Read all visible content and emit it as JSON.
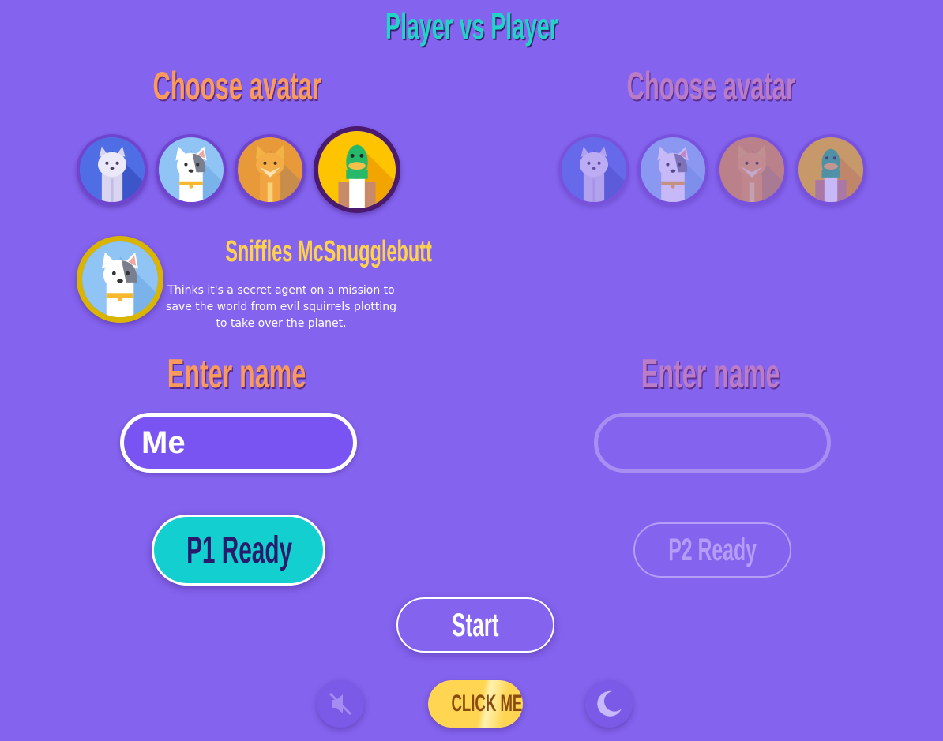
{
  "title": "Player vs Player",
  "player1": {
    "choose_label": "Choose avatar",
    "enter_label": "Enter name",
    "name_value": "Me",
    "ready_label": "P1 Ready",
    "selected_avatar": "duck",
    "avatars": [
      "cat",
      "dog",
      "fox",
      "duck"
    ]
  },
  "player2": {
    "choose_label": "Choose avatar",
    "enter_label": "Enter name",
    "name_value": "",
    "ready_label": "P2 Ready",
    "avatars": [
      "cat",
      "dog",
      "fox",
      "duck"
    ]
  },
  "profile": {
    "avatar": "dog",
    "name": "Sniffles McSnugglebutt",
    "description": "Thinks it's a secret agent on a mission to save the world from evil squirrels plotting to take over the planet."
  },
  "controls": {
    "start_label": "Start",
    "click_label": "CLICK ME!",
    "mute_icon": "speaker-muted-icon",
    "theme_icon": "moon-icon"
  },
  "colors": {
    "background": "#8463ee",
    "title": "#22d3c8",
    "heading": "#fa9a5c",
    "profile_name": "#ffd24d",
    "p1_ready": "#14cfcf",
    "click_button": "#ffd552"
  }
}
